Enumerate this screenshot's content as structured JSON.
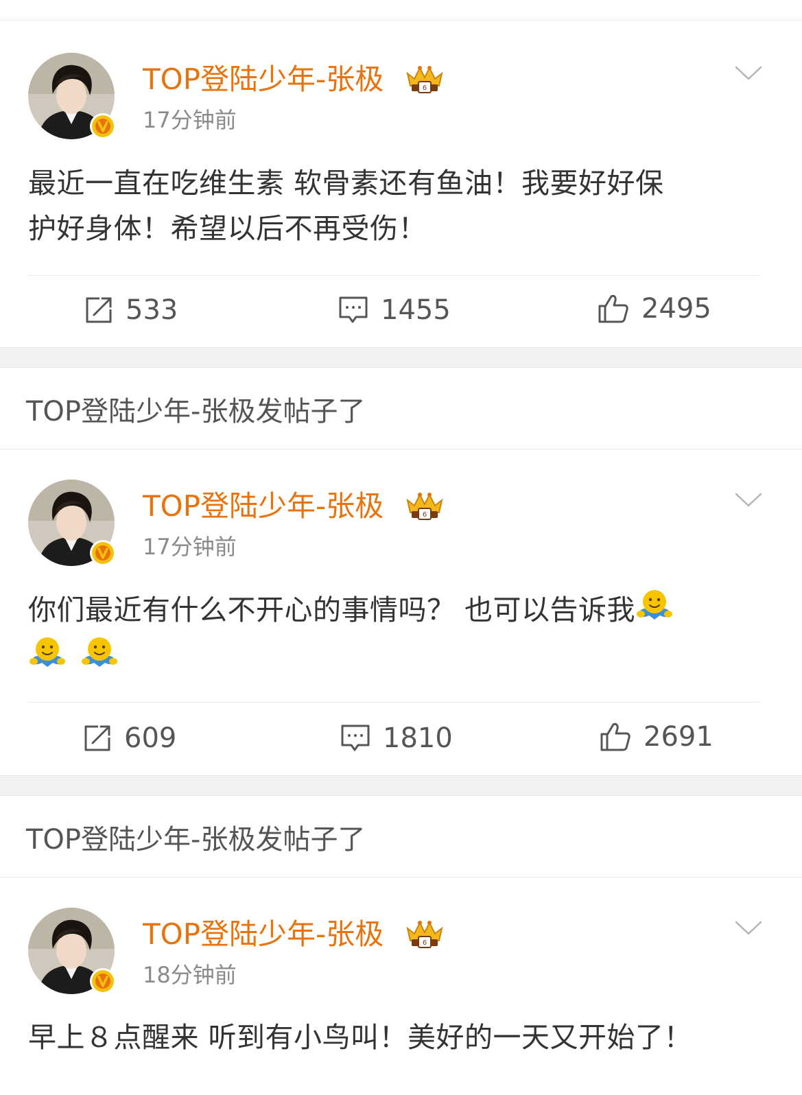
{
  "posts": [
    {
      "username": "TOP登陆少年-张极",
      "time": "17分钟前",
      "text_line1": "最近一直在吃维生素 软骨素还有鱼油！我要好好保",
      "text_line2": "护好身体！希望以后不再受伤！",
      "reposts": "533",
      "comments": "1455",
      "likes": "2495"
    },
    {
      "repost_header": "TOP登陆少年-张极发帖子了",
      "username": "TOP登陆少年-张极",
      "time": "17分钟前",
      "text_line1": "你们最近有什么不开心的事情吗？ 也可以告诉我",
      "emoji_name": "hug-emoji",
      "reposts": "609",
      "comments": "1810",
      "likes": "2691"
    },
    {
      "repost_header": "TOP登陆少年-张极发帖子了",
      "username": "TOP登陆少年-张极",
      "time": "18分钟前",
      "text_line1": "早上８点醒来 听到有小鸟叫！美好的一天又开始了！"
    }
  ],
  "icons": {
    "repost": "share-out-icon",
    "comment": "comment-bubble-icon",
    "like": "thumbs-up-icon",
    "menu": "chevron-down-icon",
    "verified": "verified-v-badge-icon",
    "vip": "crown-vip-icon"
  },
  "colors": {
    "username": "#e8720c",
    "verified_badge": "#f4c20d",
    "body_text": "#333333",
    "meta_text": "#8a8a8a",
    "separator": "#f2f2f2"
  }
}
